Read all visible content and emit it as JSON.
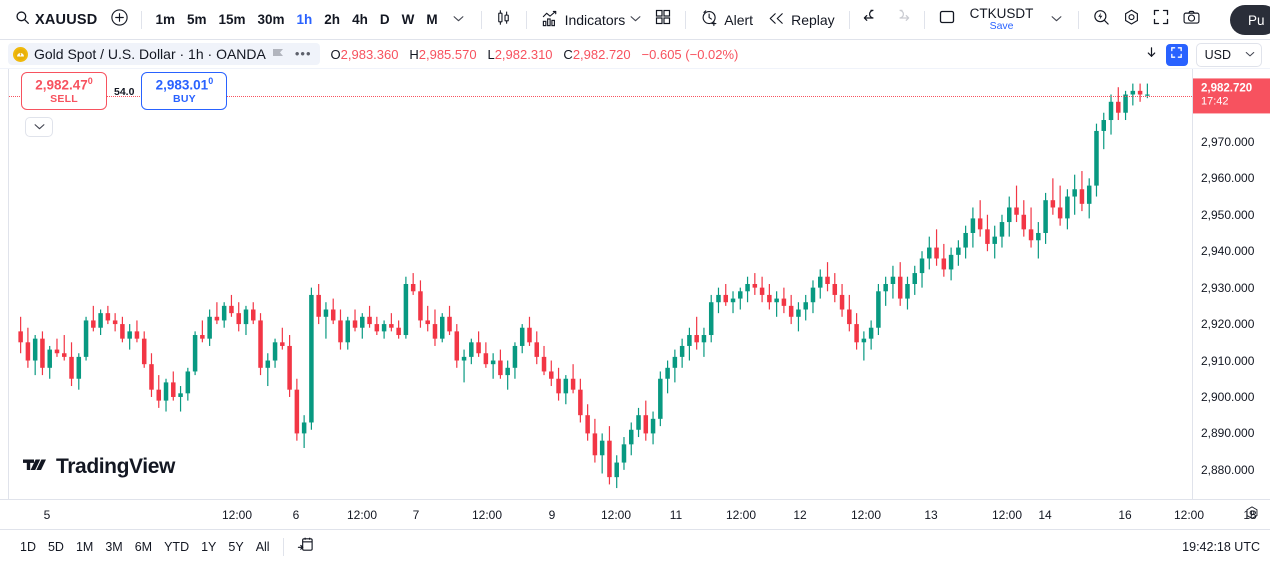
{
  "toolbar": {
    "search_icon": "search-icon",
    "symbol": "XAUUSD",
    "add_icon": "plus-circle-icon",
    "timeframes": [
      {
        "label": "1m",
        "active": false
      },
      {
        "label": "5m",
        "active": false
      },
      {
        "label": "15m",
        "active": false
      },
      {
        "label": "30m",
        "active": false
      },
      {
        "label": "1h",
        "active": true
      },
      {
        "label": "2h",
        "active": false
      },
      {
        "label": "4h",
        "active": false
      },
      {
        "label": "D",
        "active": false
      },
      {
        "label": "W",
        "active": false
      },
      {
        "label": "M",
        "active": false
      }
    ],
    "timeframe_more_icon": "chevron-down-icon",
    "chart_type_icon": "candlestick-icon",
    "indicators_label": "Indicators",
    "indicators_icon": "indicators-icon",
    "indicators_chevron": "chevron-down-icon",
    "layout_icon": "grid-layout-icon",
    "alert_label": "Alert",
    "alert_icon": "alarm-clock-icon",
    "replay_label": "Replay",
    "replay_icon": "rewind-icon",
    "undo_icon": "undo-arrow-icon",
    "redo_icon": "redo-arrow-icon",
    "layout_square_icon": "square-icon",
    "save_title": "CTKUSDT",
    "save_sub": "Save",
    "save_chevron": "chevron-down-icon",
    "quick_icon": "lightning-search-icon",
    "settings_icon": "gear-hex-icon",
    "fullscreen_icon": "fullscreen-icon",
    "snapshot_icon": "camera-icon",
    "publish_label": "Pu"
  },
  "chart_header": {
    "symbol_icon": "gold-coin-icon",
    "symbol_title": "Gold Spot / U.S. Dollar · 1h · OANDA",
    "flag_icon": "flag-icon",
    "more_icon": "more-dots-icon",
    "ohlc": [
      {
        "label": "O",
        "value": "2,983.360"
      },
      {
        "label": "H",
        "value": "2,985.570"
      },
      {
        "label": "L",
        "value": "2,982.310"
      },
      {
        "label": "C",
        "value": "2,982.720"
      }
    ],
    "change": "−0.605 (−0.02%)",
    "download_icon": "download-arrow-icon",
    "fit_screen_icon": "fit-screen-icon",
    "currency": "USD",
    "currency_chevron": "chevron-down-icon"
  },
  "trade_panel": {
    "sell_price": "2,982.47",
    "sell_price_sup": "0",
    "sell_label": "SELL",
    "spread": "54.0",
    "buy_price": "2,983.01",
    "buy_price_sup": "0",
    "buy_label": "BUY",
    "expand_icon": "chevron-down-icon"
  },
  "watermark": {
    "logo_icon": "tradingview-logo-icon",
    "text": "TradingView"
  },
  "markers": [
    {
      "type": "bolt",
      "name": "earnings-bolt-marker"
    },
    {
      "type": "flag",
      "name": "us-economic-event-marker"
    },
    {
      "type": "flag",
      "name": "us-economic-event-marker"
    }
  ],
  "price_axis": {
    "current_price": "2,982.720",
    "current_time": "17:42",
    "ticks": [
      "2,970.000",
      "2,960.000",
      "2,950.000",
      "2,940.000",
      "2,930.000",
      "2,920.000",
      "2,910.000",
      "2,900.000",
      "2,890.000",
      "2,880.000"
    ]
  },
  "time_axis": {
    "ticks": [
      "5",
      "12:00",
      "6",
      "12:00",
      "7",
      "12:00",
      "9",
      "12:00",
      "11",
      "12:00",
      "12",
      "12:00",
      "13",
      "12:00",
      "14",
      "16",
      "12:00",
      "18"
    ],
    "settings_icon": "gear-hex-icon"
  },
  "bottom_bar": {
    "ranges": [
      "1D",
      "5D",
      "1M",
      "3M",
      "6M",
      "YTD",
      "1Y",
      "5Y",
      "All"
    ],
    "calendar_icon": "goto-date-icon",
    "clock": "19:42:18 UTC"
  },
  "colors": {
    "up": "#089981",
    "down": "#f23645",
    "accent": "#2962ff",
    "price_badge": "#f7525f",
    "grid": "#e0e3eb"
  },
  "chart_data": {
    "type": "candlestick",
    "title": "Gold Spot / U.S. Dollar · 1h · OANDA",
    "ylabel": "USD",
    "ylim": [
      2872,
      2990
    ],
    "grid": false,
    "legend": "none",
    "price_line": 2982.72,
    "candles": [
      [
        2918,
        2922,
        2912,
        2915
      ],
      [
        2915,
        2919,
        2908,
        2910
      ],
      [
        2910,
        2917,
        2906,
        2916
      ],
      [
        2916,
        2918,
        2906,
        2908
      ],
      [
        2908,
        2914,
        2905,
        2913
      ],
      [
        2913,
        2916,
        2911,
        2912
      ],
      [
        2912,
        2917,
        2910,
        2911
      ],
      [
        2911,
        2915,
        2903,
        2905
      ],
      [
        2905,
        2912,
        2902,
        2911
      ],
      [
        2911,
        2922,
        2910,
        2921
      ],
      [
        2921,
        2925,
        2918,
        2919
      ],
      [
        2919,
        2924,
        2917,
        2923
      ],
      [
        2923,
        2925,
        2920,
        2921
      ],
      [
        2921,
        2923,
        2918,
        2920
      ],
      [
        2920,
        2922,
        2915,
        2916
      ],
      [
        2916,
        2920,
        2913,
        2918
      ],
      [
        2918,
        2921,
        2915,
        2916
      ],
      [
        2916,
        2918,
        2908,
        2909
      ],
      [
        2909,
        2912,
        2900,
        2902
      ],
      [
        2902,
        2906,
        2897,
        2899
      ],
      [
        2899,
        2905,
        2896,
        2904
      ],
      [
        2904,
        2907,
        2899,
        2900
      ],
      [
        2900,
        2903,
        2896,
        2901
      ],
      [
        2901,
        2908,
        2899,
        2907
      ],
      [
        2907,
        2918,
        2906,
        2917
      ],
      [
        2917,
        2921,
        2915,
        2916
      ],
      [
        2916,
        2924,
        2914,
        2922
      ],
      [
        2922,
        2926,
        2920,
        2921
      ],
      [
        2921,
        2926,
        2919,
        2925
      ],
      [
        2925,
        2928,
        2922,
        2923
      ],
      [
        2923,
        2926,
        2918,
        2920
      ],
      [
        2920,
        2925,
        2917,
        2924
      ],
      [
        2924,
        2926,
        2920,
        2921
      ],
      [
        2921,
        2923,
        2906,
        2908
      ],
      [
        2908,
        2912,
        2903,
        2910
      ],
      [
        2910,
        2916,
        2908,
        2915
      ],
      [
        2915,
        2919,
        2913,
        2914
      ],
      [
        2914,
        2917,
        2900,
        2902
      ],
      [
        2902,
        2905,
        2888,
        2890
      ],
      [
        2890,
        2895,
        2886,
        2893
      ],
      [
        2893,
        2930,
        2891,
        2928
      ],
      [
        2928,
        2931,
        2920,
        2922
      ],
      [
        2922,
        2926,
        2916,
        2924
      ],
      [
        2924,
        2927,
        2920,
        2921
      ],
      [
        2921,
        2924,
        2913,
        2915
      ],
      [
        2915,
        2922,
        2913,
        2921
      ],
      [
        2921,
        2924,
        2918,
        2919
      ],
      [
        2919,
        2923,
        2916,
        2922
      ],
      [
        2922,
        2925,
        2919,
        2920
      ],
      [
        2920,
        2922,
        2917,
        2918
      ],
      [
        2918,
        2921,
        2916,
        2920
      ],
      [
        2920,
        2923,
        2918,
        2919
      ],
      [
        2919,
        2921,
        2916,
        2917
      ],
      [
        2917,
        2933,
        2916,
        2931
      ],
      [
        2931,
        2934,
        2928,
        2929
      ],
      [
        2929,
        2932,
        2919,
        2921
      ],
      [
        2921,
        2925,
        2918,
        2920
      ],
      [
        2920,
        2924,
        2914,
        2916
      ],
      [
        2916,
        2923,
        2915,
        2922
      ],
      [
        2922,
        2925,
        2917,
        2918
      ],
      [
        2918,
        2920,
        2908,
        2910
      ],
      [
        2910,
        2913,
        2904,
        2911
      ],
      [
        2911,
        2916,
        2909,
        2915
      ],
      [
        2915,
        2918,
        2911,
        2912
      ],
      [
        2912,
        2915,
        2908,
        2909
      ],
      [
        2909,
        2912,
        2905,
        2910
      ],
      [
        2910,
        2913,
        2905,
        2906
      ],
      [
        2906,
        2910,
        2902,
        2908
      ],
      [
        2908,
        2915,
        2905,
        2914
      ],
      [
        2914,
        2920,
        2912,
        2919
      ],
      [
        2919,
        2922,
        2914,
        2915
      ],
      [
        2915,
        2918,
        2909,
        2911
      ],
      [
        2911,
        2914,
        2906,
        2907
      ],
      [
        2907,
        2910,
        2903,
        2905
      ],
      [
        2905,
        2908,
        2899,
        2901
      ],
      [
        2901,
        2906,
        2898,
        2905
      ],
      [
        2905,
        2909,
        2901,
        2902
      ],
      [
        2902,
        2905,
        2893,
        2895
      ],
      [
        2895,
        2898,
        2888,
        2890
      ],
      [
        2890,
        2894,
        2882,
        2884
      ],
      [
        2884,
        2890,
        2879,
        2888
      ],
      [
        2888,
        2892,
        2876,
        2878
      ],
      [
        2878,
        2884,
        2875,
        2882
      ],
      [
        2882,
        2889,
        2880,
        2887
      ],
      [
        2887,
        2893,
        2884,
        2891
      ],
      [
        2891,
        2897,
        2889,
        2895
      ],
      [
        2895,
        2899,
        2888,
        2890
      ],
      [
        2890,
        2896,
        2887,
        2894
      ],
      [
        2894,
        2907,
        2892,
        2905
      ],
      [
        2905,
        2910,
        2901,
        2908
      ],
      [
        2908,
        2913,
        2904,
        2911
      ],
      [
        2911,
        2916,
        2908,
        2914
      ],
      [
        2914,
        2919,
        2910,
        2917
      ],
      [
        2917,
        2922,
        2913,
        2915
      ],
      [
        2915,
        2919,
        2911,
        2917
      ],
      [
        2917,
        2928,
        2915,
        2926
      ],
      [
        2926,
        2930,
        2923,
        2928
      ],
      [
        2928,
        2931,
        2925,
        2926
      ],
      [
        2926,
        2929,
        2923,
        2927
      ],
      [
        2927,
        2930,
        2924,
        2929
      ],
      [
        2929,
        2933,
        2926,
        2931
      ],
      [
        2931,
        2934,
        2928,
        2930
      ],
      [
        2930,
        2933,
        2926,
        2928
      ],
      [
        2928,
        2931,
        2924,
        2926
      ],
      [
        2926,
        2929,
        2922,
        2927
      ],
      [
        2927,
        2930,
        2923,
        2925
      ],
      [
        2925,
        2928,
        2920,
        2922
      ],
      [
        2922,
        2926,
        2918,
        2924
      ],
      [
        2924,
        2928,
        2921,
        2926
      ],
      [
        2926,
        2932,
        2923,
        2930
      ],
      [
        2930,
        2935,
        2927,
        2933
      ],
      [
        2933,
        2937,
        2929,
        2931
      ],
      [
        2931,
        2934,
        2926,
        2928
      ],
      [
        2928,
        2931,
        2922,
        2924
      ],
      [
        2924,
        2928,
        2918,
        2920
      ],
      [
        2920,
        2923,
        2913,
        2915
      ],
      [
        2915,
        2918,
        2910,
        2916
      ],
      [
        2916,
        2921,
        2913,
        2919
      ],
      [
        2919,
        2931,
        2917,
        2929
      ],
      [
        2929,
        2933,
        2925,
        2931
      ],
      [
        2931,
        2936,
        2927,
        2933
      ],
      [
        2933,
        2937,
        2925,
        2927
      ],
      [
        2927,
        2933,
        2924,
        2931
      ],
      [
        2931,
        2936,
        2928,
        2934
      ],
      [
        2934,
        2940,
        2930,
        2938
      ],
      [
        2938,
        2944,
        2935,
        2941
      ],
      [
        2941,
        2946,
        2936,
        2938
      ],
      [
        2938,
        2942,
        2933,
        2935
      ],
      [
        2935,
        2941,
        2932,
        2939
      ],
      [
        2939,
        2943,
        2936,
        2941
      ],
      [
        2941,
        2947,
        2938,
        2945
      ],
      [
        2945,
        2952,
        2941,
        2949
      ],
      [
        2949,
        2954,
        2944,
        2946
      ],
      [
        2946,
        2950,
        2940,
        2942
      ],
      [
        2942,
        2947,
        2938,
        2944
      ],
      [
        2944,
        2950,
        2941,
        2948
      ],
      [
        2948,
        2955,
        2944,
        2952
      ],
      [
        2952,
        2958,
        2948,
        2950
      ],
      [
        2950,
        2954,
        2944,
        2946
      ],
      [
        2946,
        2952,
        2941,
        2943
      ],
      [
        2943,
        2948,
        2938,
        2945
      ],
      [
        2945,
        2956,
        2942,
        2954
      ],
      [
        2954,
        2960,
        2950,
        2952
      ],
      [
        2952,
        2958,
        2947,
        2949
      ],
      [
        2949,
        2957,
        2946,
        2955
      ],
      [
        2955,
        2961,
        2950,
        2957
      ],
      [
        2957,
        2962,
        2951,
        2953
      ],
      [
        2953,
        2960,
        2949,
        2958
      ],
      [
        2958,
        2975,
        2955,
        2973
      ],
      [
        2973,
        2978,
        2968,
        2976
      ],
      [
        2976,
        2983,
        2972,
        2981
      ],
      [
        2981,
        2985,
        2976,
        2978
      ],
      [
        2978,
        2984,
        2976,
        2983
      ],
      [
        2983,
        2986,
        2980,
        2984
      ],
      [
        2984,
        2986,
        2981,
        2983
      ],
      [
        2983,
        2986,
        2982,
        2983
      ]
    ]
  }
}
